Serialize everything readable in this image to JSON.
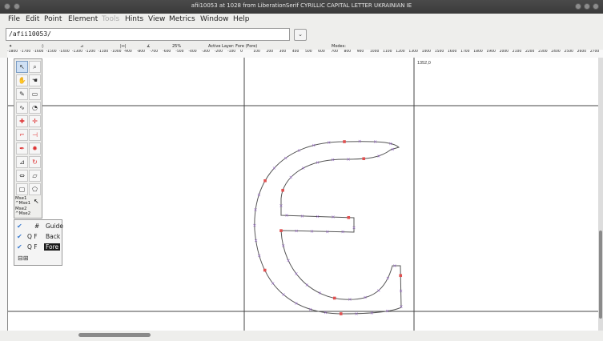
{
  "window": {
    "title": "afii10053 at 1028 from LiberationSerif CYRILLIC CAPITAL LETTER UKRAINIAN IE"
  },
  "menu": [
    {
      "label": "File"
    },
    {
      "label": "Edit"
    },
    {
      "label": "Point"
    },
    {
      "label": "Element"
    },
    {
      "label": "Tools",
      "disabled": true
    },
    {
      "label": "Hints"
    },
    {
      "label": "View"
    },
    {
      "label": "Metrics"
    },
    {
      "label": "Window"
    },
    {
      "label": "Help"
    }
  ],
  "glyph_field": {
    "value": "/afii10053/"
  },
  "info": {
    "zoom": "25%",
    "active_layer": "Active Layer: Fore (Fore)",
    "modes": "Modes:"
  },
  "ruler_labels": [
    "-1800",
    "-1700",
    "-1600",
    "-1500",
    "-1400",
    "-1300",
    "-1200",
    "-1100",
    "-1000",
    "-900",
    "-800",
    "-700",
    "-600",
    "-500",
    "-400",
    "-300",
    "-200",
    "-100",
    "0",
    "100",
    "200",
    "300",
    "400",
    "500",
    "600",
    "700",
    "800",
    "900",
    "1000",
    "1100",
    "1200",
    "1300",
    "1400",
    "1500",
    "1600",
    "1700",
    "1800",
    "1900",
    "2000",
    "2100",
    "2200",
    "2300",
    "2400",
    "2500",
    "2600",
    "2700"
  ],
  "coord_readout": "1352,0",
  "palette_labels": [
    "Mse1",
    "^Mse1",
    "Mse2",
    "^Mse2"
  ],
  "layers": [
    {
      "prefix": "#",
      "name": "Guide",
      "checked": true,
      "selected": false
    },
    {
      "prefix": "Q F",
      "name": "Back",
      "checked": true,
      "selected": false
    },
    {
      "prefix": "Q F",
      "name": "Fore",
      "checked": true,
      "selected": true
    }
  ],
  "colors": {
    "outline": "#555555",
    "point_oncurve": "#e05050",
    "point_offcurve": "#9060c0",
    "guide": "#444444"
  }
}
